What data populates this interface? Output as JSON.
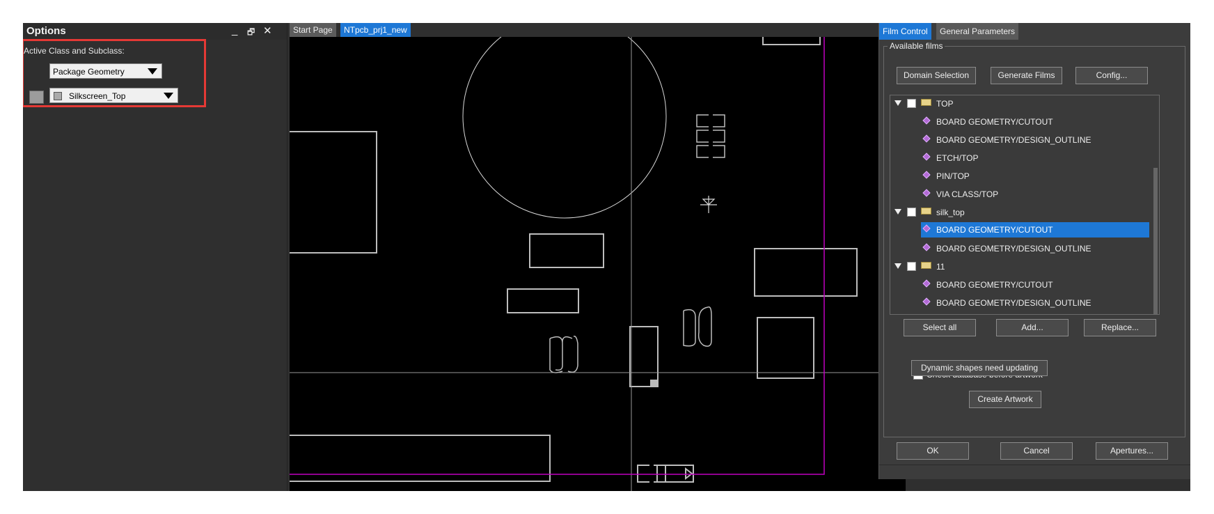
{
  "options": {
    "title": "Options",
    "controls": [
      "_",
      "🗗",
      "✕"
    ],
    "active_label": "Active Class and Subclass:",
    "class_value": "Package Geometry",
    "subclass_value": "Silkscreen_Top"
  },
  "tabs": [
    "Start Page",
    "NTpcb_prj1_new"
  ],
  "film": {
    "tabs": [
      "Film Control",
      "General Parameters"
    ],
    "group_label": "Available films",
    "top_buttons": [
      "Domain Selection",
      "Generate Films",
      "Config..."
    ],
    "tree": [
      {
        "type": "folder",
        "label": "TOP"
      },
      {
        "type": "item",
        "label": "BOARD GEOMETRY/CUTOUT"
      },
      {
        "type": "item",
        "label": "BOARD GEOMETRY/DESIGN_OUTLINE"
      },
      {
        "type": "item",
        "label": "ETCH/TOP"
      },
      {
        "type": "item",
        "label": "PIN/TOP"
      },
      {
        "type": "item",
        "label": "VIA CLASS/TOP"
      },
      {
        "type": "folder",
        "label": "silk_top"
      },
      {
        "type": "item",
        "label": "BOARD GEOMETRY/CUTOUT",
        "selected": true
      },
      {
        "type": "item",
        "label": "BOARD GEOMETRY/DESIGN_OUTLINE"
      },
      {
        "type": "folder",
        "label": "11"
      },
      {
        "type": "item",
        "label": "BOARD GEOMETRY/CUTOUT"
      },
      {
        "type": "item",
        "label": "BOARD GEOMETRY/DESIGN_OUTLINE"
      }
    ],
    "list_buttons": [
      "Select all",
      "Add...",
      "Replace..."
    ],
    "check_db_label": "Check database before artwork",
    "check_db_checked": true,
    "dynamic_button": "Dynamic shapes need updating",
    "create_button": "Create Artwork",
    "bottom_buttons": [
      "OK",
      "Cancel",
      "Apertures..."
    ]
  },
  "colors": {
    "accent": "#1e78d6",
    "highlight": "#e53935",
    "board_outline": "#c000c0",
    "trace": "#bfbfbf"
  }
}
